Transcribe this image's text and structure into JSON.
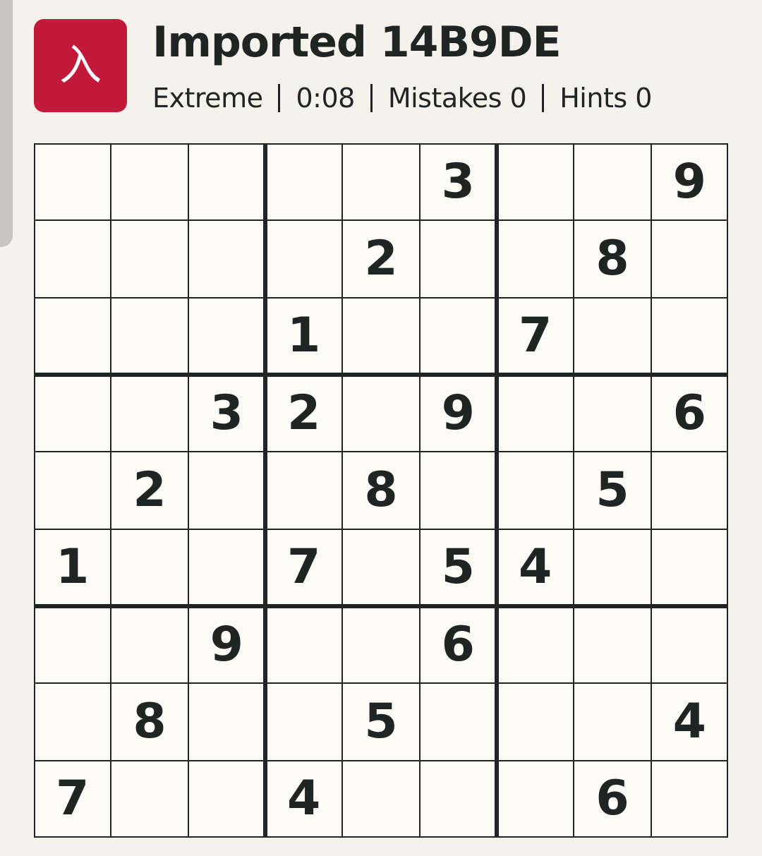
{
  "header": {
    "icon_glyph": "入",
    "title": "Imported 14B9DE",
    "difficulty": "Extreme",
    "timer": "0:08",
    "mistakes": "Mistakes 0",
    "hints": "Hints 0"
  },
  "board": {
    "rows": [
      [
        "",
        "",
        "",
        "",
        "",
        "3",
        "",
        "",
        "9"
      ],
      [
        "",
        "",
        "",
        "",
        "2",
        "",
        "",
        "8",
        ""
      ],
      [
        "",
        "",
        "",
        "1",
        "",
        "",
        "7",
        "",
        ""
      ],
      [
        "",
        "",
        "3",
        "2",
        "",
        "9",
        "",
        "",
        "6"
      ],
      [
        "",
        "2",
        "",
        "",
        "8",
        "",
        "",
        "5",
        ""
      ],
      [
        "1",
        "",
        "",
        "7",
        "",
        "5",
        "4",
        "",
        ""
      ],
      [
        "",
        "",
        "9",
        "",
        "",
        "6",
        "",
        "",
        ""
      ],
      [
        "",
        "8",
        "",
        "",
        "5",
        "",
        "",
        "",
        "4"
      ],
      [
        "7",
        "",
        "",
        "4",
        "",
        "",
        "",
        "6",
        ""
      ]
    ]
  },
  "colors": {
    "accent": "#c4193a",
    "background": "#f5f2ec",
    "board": "#fdfbf5",
    "ink": "#1f2523"
  }
}
